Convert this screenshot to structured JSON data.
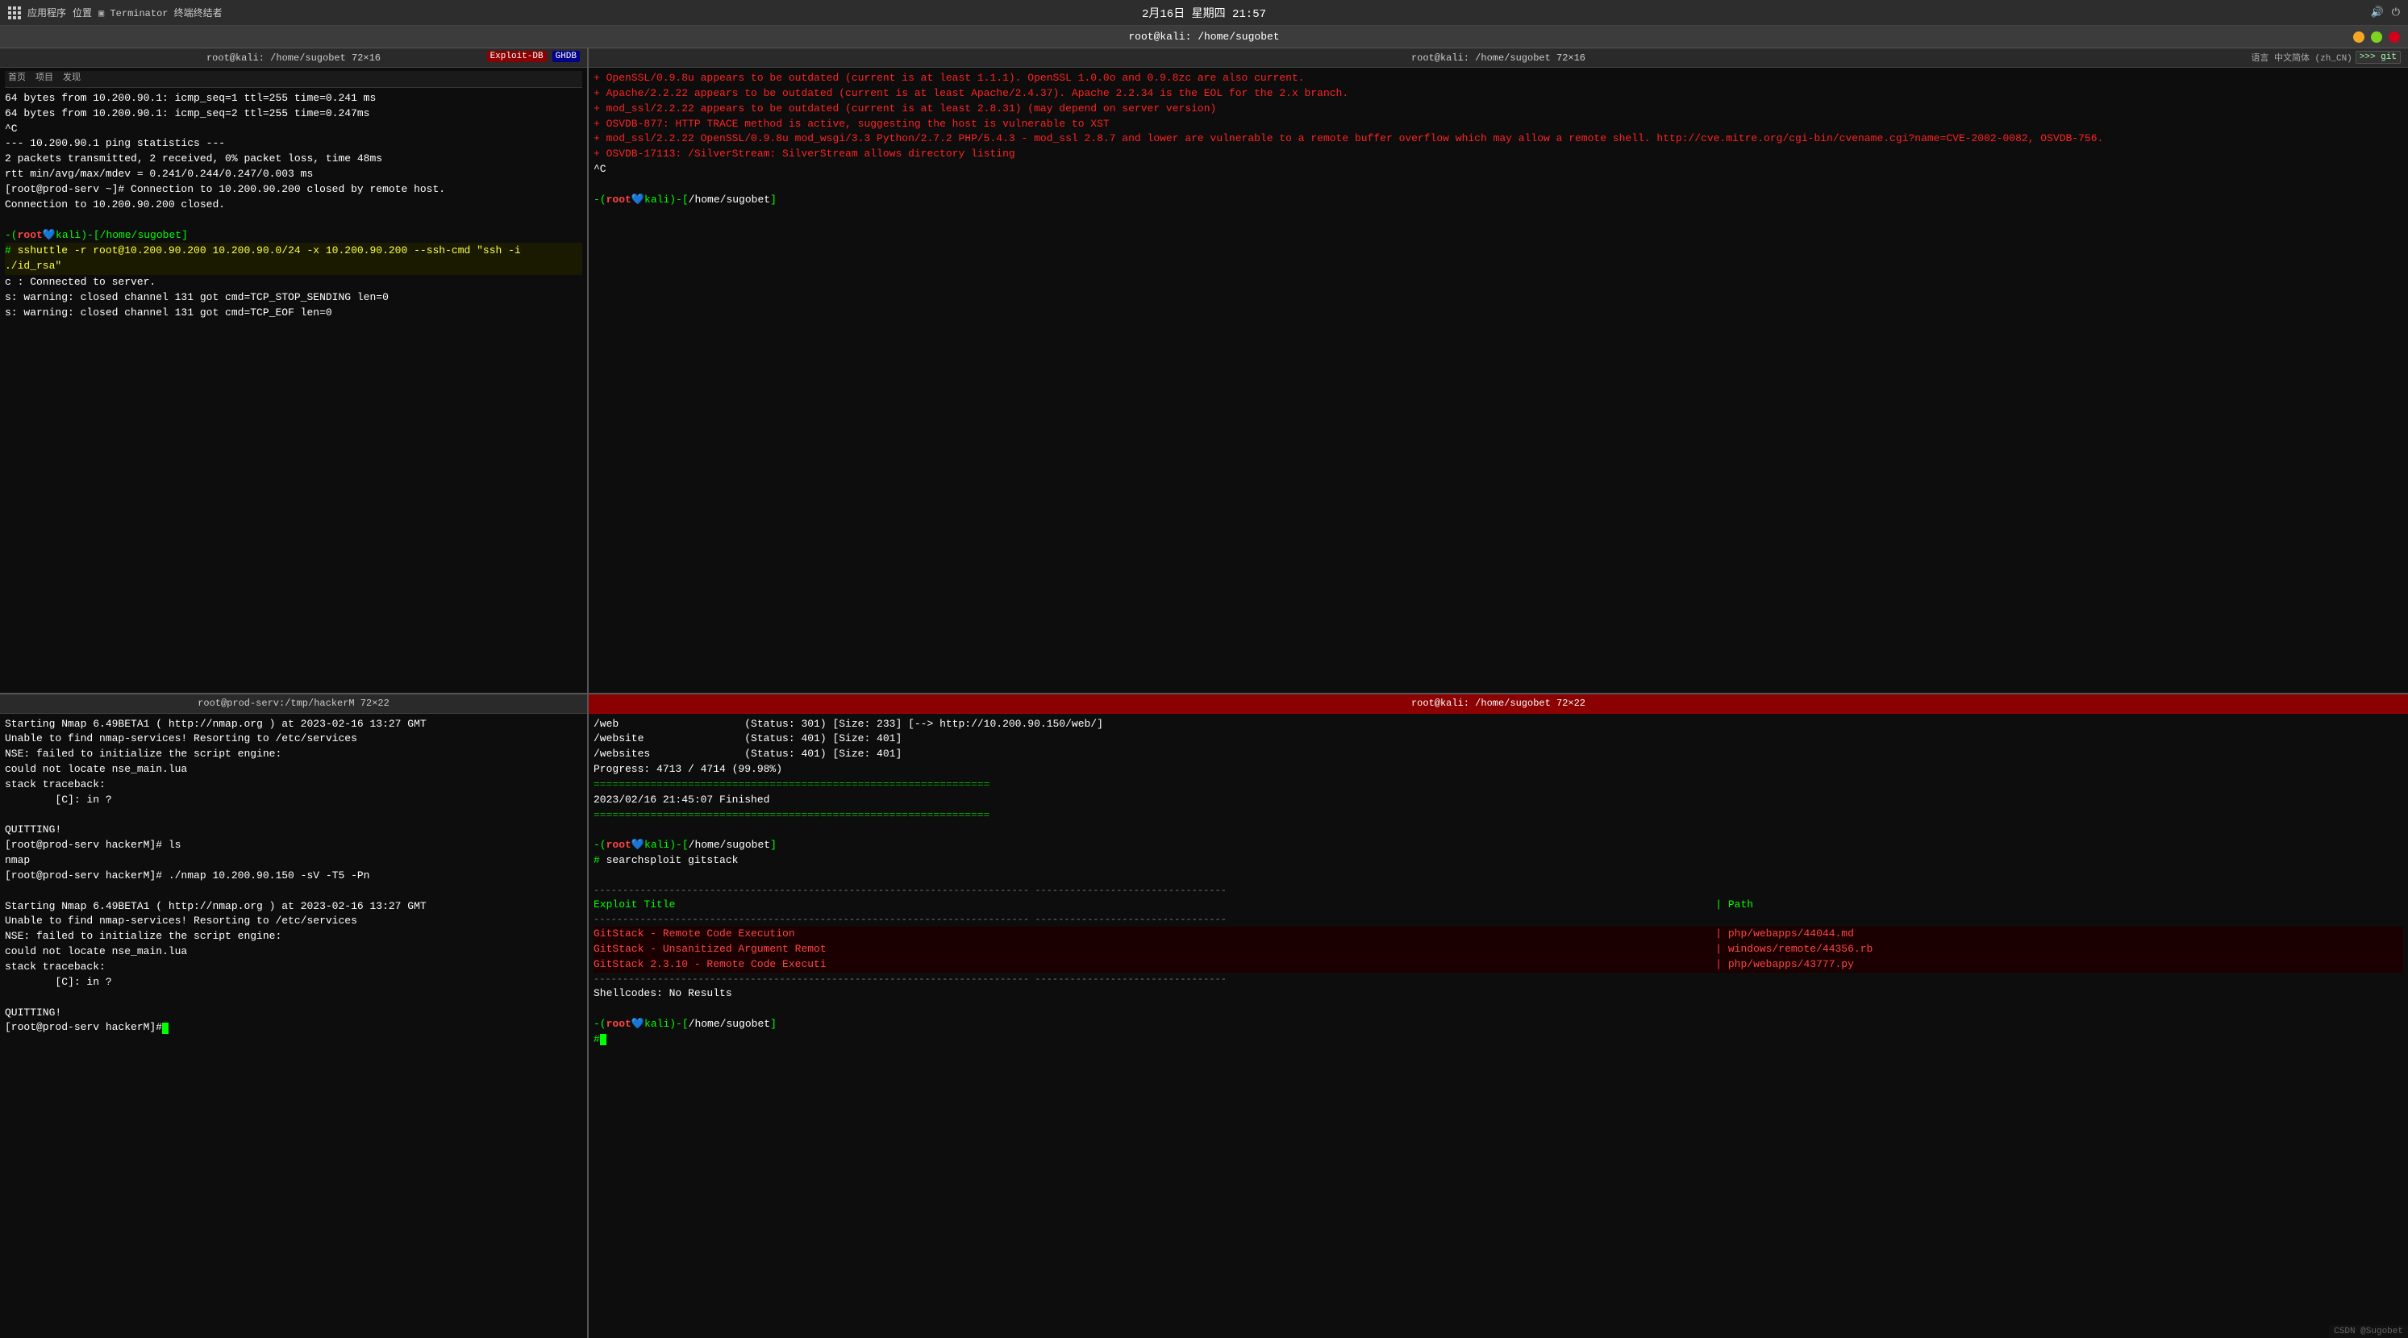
{
  "taskbar": {
    "date_time": "2月16日 星期四 21:57",
    "apps_label": "应用程序",
    "position_label": "位置",
    "terminal_label": "Terminator 终端终结者"
  },
  "window": {
    "title": "root@kali: /home/sugobet",
    "top_left_title": "root@kali: /home/sugobet 72×16",
    "top_right_title": "root@kali: /home/sugobet 72×16",
    "bottom_left_title": "root@prod-serv:/tmp/hackerM 72×22",
    "bottom_right_title": "root@kali: /home/sugobet 72×22"
  },
  "top_left_terminal": {
    "lines": [
      {
        "text": "64 bytes from 10.200.90.1: icmp_seq=1 ttl=255 time=0.241 ms",
        "color": "white"
      },
      {
        "text": "64 bytes from 10.200.90.1: icmp_seq=2 ttl=255 time=0.247ms",
        "color": "white"
      },
      {
        "text": "^C",
        "color": "white"
      },
      {
        "text": "--- 10.200.90.1 ping statistics ---",
        "color": "white"
      },
      {
        "text": "2 packets transmitted, 2 received, 0% packet loss, time 48ms",
        "color": "white"
      },
      {
        "text": "rtt min/avg/max/mdev = 0.241/0.244/0.247/0.003 ms",
        "color": "white"
      },
      {
        "text": "[root@prod-serv ~]# Connection to 10.200.90.200 closed by remote host.",
        "color": "white"
      },
      {
        "text": "Connection to 10.200.90.200 closed.",
        "color": "white"
      }
    ],
    "prompt_user": "root",
    "prompt_path": "/home/sugobet",
    "command": "# sshuttle -r root@10.200.90.200 10.200.90.0/24 -x 10.200.90.200 --ssh-cmd \"ssh -i ./id_rsa\"",
    "output_lines": [
      {
        "text": "c : Connected to server.",
        "color": "white"
      },
      {
        "text": "s: warning: closed channel 131 got cmd=TCP_STOP_SENDING len=0",
        "color": "white"
      },
      {
        "text": "s: warning: closed channel 131 got cmd=TCP_EOF len=0",
        "color": "white"
      }
    ]
  },
  "top_right_terminal": {
    "lines": [
      {
        "text": "+ OpenSSL/0.9.8u appears to be outdated (current is at least 1.1.1). OpenSSL 1.0.0o and 0.9.8zc are also current.",
        "color": "bright-red"
      },
      {
        "text": "+ Apache/2.2.22 appears to be outdated (current is at least Apache/2.4.37). Apache 2.2.34 is the EOL for the 2.x branch.",
        "color": "bright-red"
      },
      {
        "text": "+ mod_ssl/2.2.22 appears to be outdated (current is at least 2.8.31) (may depend on server version)",
        "color": "bright-red"
      },
      {
        "text": "+ OSVDB-877: HTTP TRACE method is active, suggesting the host is vulnerable to XST",
        "color": "bright-red"
      },
      {
        "text": "+ mod_ssl/2.2.22 OpenSSL/0.9.8u mod_wsgi/3.3 Python/2.7.2 PHP/5.4.3 - mod_ssl 2.8.7 and lower are vulnerable to a remote buffer overflow which may allow a remote shell. http://cve.mitre.org/cgi-bin/cvename.cgi?name=CVE-2002-0082, OSVDB-756.",
        "color": "bright-red"
      },
      {
        "text": "+ OSVDB-17113: /SilverStream: SilverStream allows directory listing",
        "color": "bright-red"
      },
      {
        "text": "^C",
        "color": "white"
      }
    ],
    "prompt_user": "root",
    "prompt_path": "/home/sugobet"
  },
  "bottom_left_terminal": {
    "title": "root@prod-serv:/tmp/hackerM 72×22",
    "lines": [
      {
        "text": "Starting Nmap 6.49BETA1 ( http://nmap.org ) at 2023-02-16 13:27 GMT",
        "color": "white"
      },
      {
        "text": "Unable to find nmap-services!  Resorting to /etc/services",
        "color": "white"
      },
      {
        "text": "NSE: failed to initialize the script engine:",
        "color": "white"
      },
      {
        "text": "could not locate nse_main.lua",
        "color": "white"
      },
      {
        "text": "stack traceback:",
        "color": "white"
      },
      {
        "text": "        [C]: in ?",
        "color": "white"
      },
      {
        "text": "",
        "color": "white"
      },
      {
        "text": "QUITTING!",
        "color": "white"
      },
      {
        "text": "[root@prod-serv hackerM]# ls",
        "color": "white"
      },
      {
        "text": "nmap",
        "color": "white"
      },
      {
        "text": "[root@prod-serv hackerM]# ./nmap 10.200.90.150 -sV -T5 -Pn",
        "color": "white"
      },
      {
        "text": "",
        "color": "white"
      },
      {
        "text": "Starting Nmap 6.49BETA1 ( http://nmap.org ) at 2023-02-16 13:27 GMT",
        "color": "white"
      },
      {
        "text": "Unable to find nmap-services!  Resorting to /etc/services",
        "color": "white"
      },
      {
        "text": "NSE: failed to initialize the script engine:",
        "color": "white"
      },
      {
        "text": "could not locate nse_main.lua",
        "color": "white"
      },
      {
        "text": "stack traceback:",
        "color": "white"
      },
      {
        "text": "        [C]: in ?",
        "color": "white"
      },
      {
        "text": "",
        "color": "white"
      },
      {
        "text": "QUITTING!",
        "color": "white"
      },
      {
        "text": "[root@prod-serv hackerM]# ",
        "color": "white"
      }
    ]
  },
  "bottom_right_terminal": {
    "title": "root@kali: /home/sugobet 72×22",
    "lines": [
      {
        "text": "/web                    (Status: 301) [Size: 233] [--> http://10.200.90.150/web/]",
        "color": "white"
      },
      {
        "text": "/website                (Status: 401) [Size: 401]",
        "color": "white"
      },
      {
        "text": "/websites               (Status: 401) [Size: 401]",
        "color": "white"
      },
      {
        "text": "Progress: 4713 / 4714 (99.98%)",
        "color": "white"
      },
      {
        "text": "===============================================================",
        "color": "white"
      },
      {
        "text": "2023/02/16 21:45:07 Finished",
        "color": "white"
      },
      {
        "text": "===============================================================",
        "color": "white"
      }
    ],
    "prompt_user": "root",
    "prompt_path": "/home/sugobet",
    "command": "# searchsploit gitstack",
    "searchsploit_header": "--------------------------------------------------------------------------- ---------------------------------",
    "searchsploit_col1": " Exploit Title",
    "searchsploit_col2": "| Path",
    "searchsploit_divider": "--------------------------------------------------------------------------- ---------------------------------",
    "exploits": [
      {
        "title": "GitStack - Remote Code Execution",
        "path": "| php/webapps/44044.md"
      },
      {
        "title": "GitStack - Unsanitized Argument Remot",
        "path": "| windows/remote/44356.rb"
      },
      {
        "title": "GitStack 2.3.10 - Remote Code Executi",
        "path": "| php/webapps/43777.py"
      }
    ],
    "searchsploit_footer": "--------------------------------------------------------------------------- ---------------------------------",
    "shellcodes_label": "Shellcodes: No Results",
    "final_prompt_user": "root",
    "final_prompt_path": "/home/sugobet",
    "cursor": "#"
  },
  "badges": {
    "exploit": "Exploit-DB",
    "ghdb": "GHDB",
    "lang": "语言",
    "lang_value": "中文简体 (zh_CN)",
    "git": ">>> git"
  },
  "bottom_watermark": "CSDN @Sugobet"
}
